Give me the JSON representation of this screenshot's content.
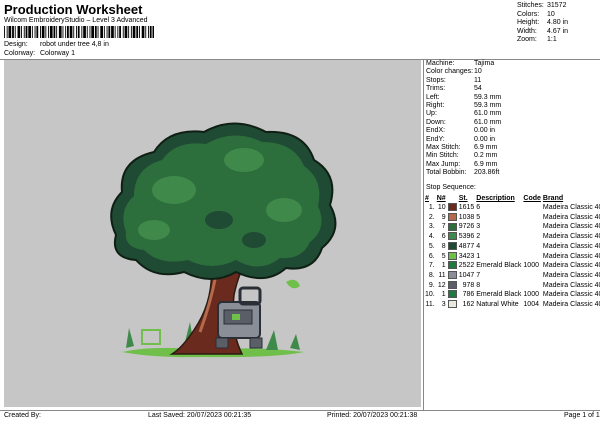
{
  "header": {
    "title": "Production Worksheet",
    "subtitle": "Wilcom EmbroideryStudio – Level 3 Advanced",
    "design_label": "Design:",
    "design_value": "robot under  tree 4,8 in",
    "colorway_label": "Colorway:",
    "colorway_value": "Colorway 1"
  },
  "stats": [
    {
      "label": "Stitches:",
      "value": "31572"
    },
    {
      "label": "Colors:",
      "value": "10"
    },
    {
      "label": "Height:",
      "value": "4.80 in"
    },
    {
      "label": "Width:",
      "value": "4.67 in"
    },
    {
      "label": "Zoom:",
      "value": "1:1"
    }
  ],
  "info": [
    {
      "label": "Machine:",
      "value": "Tajima"
    },
    {
      "label": "Color changes:",
      "value": "10"
    },
    {
      "label": "Stops:",
      "value": "11"
    },
    {
      "label": "Trims:",
      "value": "54"
    },
    {
      "label": "Left:",
      "value": "59.3 mm"
    },
    {
      "label": "Right:",
      "value": "59.3 mm"
    },
    {
      "label": "Up:",
      "value": "61.0 mm"
    },
    {
      "label": "Down:",
      "value": "61.0 mm"
    },
    {
      "label": "EndX:",
      "value": "0.00 in"
    },
    {
      "label": "EndY:",
      "value": "0.00 in"
    },
    {
      "label": "Max Stitch:",
      "value": "6.9 mm"
    },
    {
      "label": "Min Stitch:",
      "value": "0.2 mm"
    },
    {
      "label": "Max Jump:",
      "value": "6.9 mm"
    },
    {
      "label": "Total Bobbin:",
      "value": "203.86ft"
    }
  ],
  "stop_sequence": {
    "title": "Stop Sequence:",
    "headers": [
      "#",
      "N#",
      "St.",
      "Description",
      "Code",
      "Brand"
    ],
    "rows": [
      {
        "idx": "1.",
        "n": "10",
        "color": "#6b2a1e",
        "st": "1615",
        "desc": "6",
        "code": "",
        "brand": "Madeira Classic 40"
      },
      {
        "idx": "2.",
        "n": "9",
        "color": "#b56a4c",
        "st": "1038",
        "desc": "5",
        "code": "",
        "brand": "Madeira Classic 40"
      },
      {
        "idx": "3.",
        "n": "7",
        "color": "#2c6e3c",
        "st": "9726",
        "desc": "3",
        "code": "",
        "brand": "Madeira Classic 40"
      },
      {
        "idx": "4.",
        "n": "6",
        "color": "#3f8a4a",
        "st": "5396",
        "desc": "2",
        "code": "",
        "brand": "Madeira Classic 40"
      },
      {
        "idx": "5.",
        "n": "8",
        "color": "#1f4a33",
        "st": "4877",
        "desc": "4",
        "code": "",
        "brand": "Madeira Classic 40"
      },
      {
        "idx": "6.",
        "n": "5",
        "color": "#6fbf4a",
        "st": "3423",
        "desc": "1",
        "code": "",
        "brand": "Madeira Classic 40"
      },
      {
        "idx": "7.",
        "n": "1",
        "color": "#1e7a3e",
        "st": "2522",
        "desc": "Emerald Black",
        "code": "1000",
        "brand": "Madeira Classic 40"
      },
      {
        "idx": "8.",
        "n": "11",
        "color": "#8a8e96",
        "st": "1047",
        "desc": "7",
        "code": "",
        "brand": "Madeira Classic 40"
      },
      {
        "idx": "9.",
        "n": "12",
        "color": "#5a5e66",
        "st": "978",
        "desc": "8",
        "code": "",
        "brand": "Madeira Classic 40"
      },
      {
        "idx": "10.",
        "n": "1",
        "color": "#1e7a3e",
        "st": "786",
        "desc": "Emerald Black",
        "code": "1000",
        "brand": "Madeira Classic 40"
      },
      {
        "idx": "11.",
        "n": "3",
        "color": "#e8e8e0",
        "st": "162",
        "desc": "Natural White",
        "code": "1004",
        "brand": "Madeira Classic 40"
      }
    ]
  },
  "footer": {
    "created_by": "Created By:",
    "last_saved": "Last Saved: 20/07/2023 00:21:35",
    "printed": "Printed: 20/07/2023 00:21:38",
    "page": "Page 1 of 1"
  },
  "colors": {
    "panel_bg": "#c6c6c6",
    "leaf_dark": "#1f4a33",
    "leaf_mid": "#2c6e3c",
    "leaf_light": "#3f8a4a",
    "trunk": "#6b2a1e",
    "grass": "#6fbf4a"
  }
}
